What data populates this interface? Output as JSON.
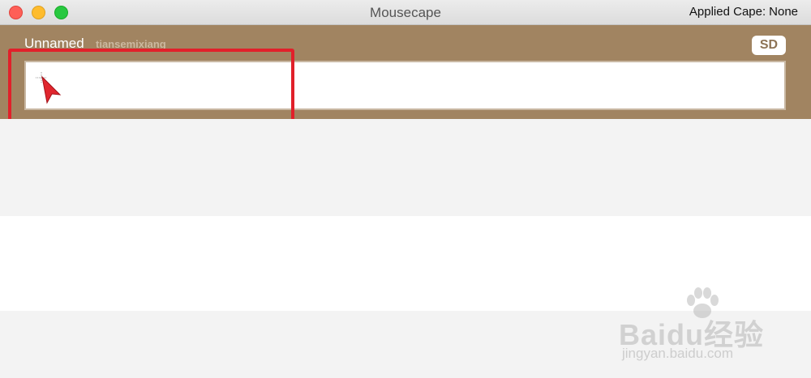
{
  "window": {
    "title": "Mousecape",
    "applied_label": "Applied Cape:",
    "applied_value": "None"
  },
  "cape": {
    "name": "Unnamed",
    "author": "tiansemixiang",
    "badge": "SD",
    "cursor_icon": "pointer-arrow-icon"
  },
  "colors": {
    "cape_row_bg": "#a18461",
    "highlight": "#e1202a",
    "list_alt_bg": "#f3f3f3"
  },
  "watermark": {
    "brand": "Baidu经验",
    "url": "jingyan.baidu.com"
  }
}
